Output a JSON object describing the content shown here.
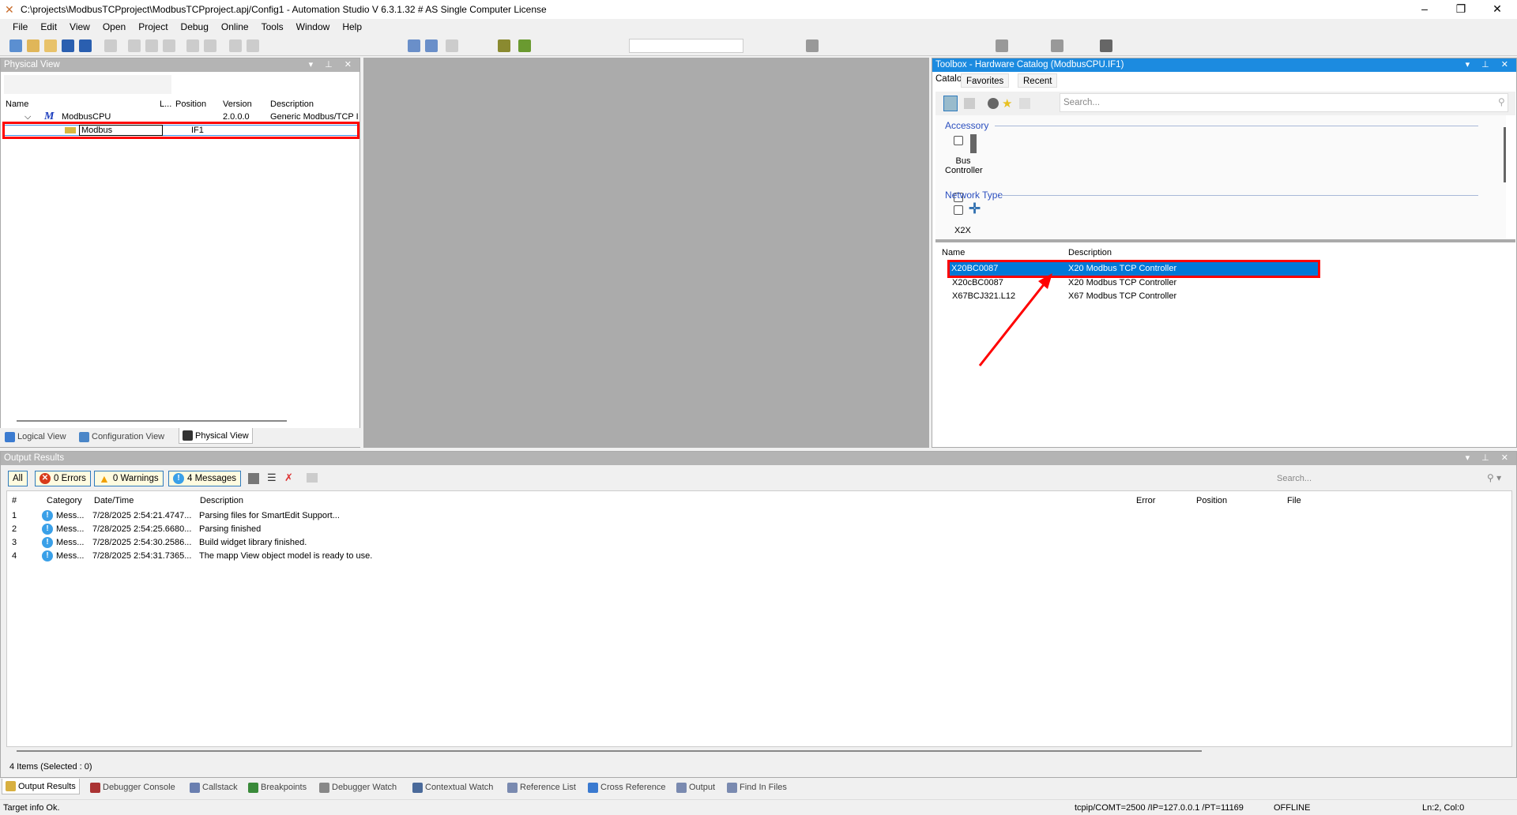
{
  "window": {
    "title": "C:\\projects\\ModbusTCPproject\\ModbusTCPproject.apj/Config1 - Automation Studio V 6.3.1.32 # AS Single Computer License"
  },
  "menu": [
    "File",
    "Edit",
    "View",
    "Open",
    "Project",
    "Debug",
    "Online",
    "Tools",
    "Window",
    "Help"
  ],
  "physical_view": {
    "title": "Physical View",
    "columns": [
      "Name",
      "L...",
      "Position",
      "Version",
      "Description"
    ],
    "rows": [
      {
        "name": "ModbusCPU",
        "position": "",
        "version": "2.0.0.0",
        "description": "Generic Modbus/TCP I"
      },
      {
        "name": "Modbus",
        "position": "IF1",
        "version": "",
        "description": ""
      }
    ],
    "tabs": [
      "Logical View",
      "Configuration View",
      "Physical View"
    ]
  },
  "toolbox": {
    "title": "Toolbox - Hardware Catalog (ModbusCPU.IF1)",
    "tabs": [
      "Catalog",
      "Favorites",
      "Recent"
    ],
    "search_placeholder": "Search...",
    "groups": [
      {
        "label": "Accessory",
        "items": [
          "Bus Controller"
        ]
      },
      {
        "label": "Network Type",
        "items": [
          "X2X"
        ]
      }
    ],
    "columns": [
      "Name",
      "Description"
    ],
    "rows": [
      {
        "name": "X20BC0087",
        "description": "X20 Modbus TCP Controller",
        "selected": true
      },
      {
        "name": "X20cBC0087",
        "description": "X20 Modbus TCP Controller"
      },
      {
        "name": "X67BCJ321.L12",
        "description": "X67 Modbus TCP Controller"
      }
    ]
  },
  "output": {
    "title": "Output Results",
    "filters": {
      "all": "All",
      "errors": "0 Errors",
      "warnings": "0 Warnings",
      "messages": "4 Messages"
    },
    "search_placeholder": "Search...",
    "columns": [
      "#",
      "Category",
      "Date/Time",
      "Description",
      "Error",
      "Position",
      "File"
    ],
    "rows": [
      {
        "n": "1",
        "category": "Mess...",
        "datetime": "7/28/2025 2:54:21.4747...",
        "description": "Parsing files for SmartEdit Support..."
      },
      {
        "n": "2",
        "category": "Mess...",
        "datetime": "7/28/2025 2:54:25.6680...",
        "description": "Parsing finished"
      },
      {
        "n": "3",
        "category": "Mess...",
        "datetime": "7/28/2025 2:54:30.2586...",
        "description": "Build widget library finished."
      },
      {
        "n": "4",
        "category": "Mess...",
        "datetime": "7/28/2025 2:54:31.7365...",
        "description": "The mapp View object model is ready to use."
      }
    ],
    "summary": "4 Items (Selected : 0)"
  },
  "bottom_tabs": [
    "Output Results",
    "Debugger Console",
    "Callstack",
    "Breakpoints",
    "Debugger Watch",
    "Contextual Watch",
    "Reference List",
    "Cross Reference",
    "Output",
    "Find In Files"
  ],
  "status": {
    "left": "Target info Ok.",
    "connection": "tcpip/COMT=2500 /IP=127.0.0.1 /PT=11169",
    "mode": "OFFLINE",
    "position": "Ln:2, Col:0"
  },
  "colors": {
    "accent": "#1c8be0",
    "selection": "#0078d7",
    "highlight": "#ff0000"
  }
}
